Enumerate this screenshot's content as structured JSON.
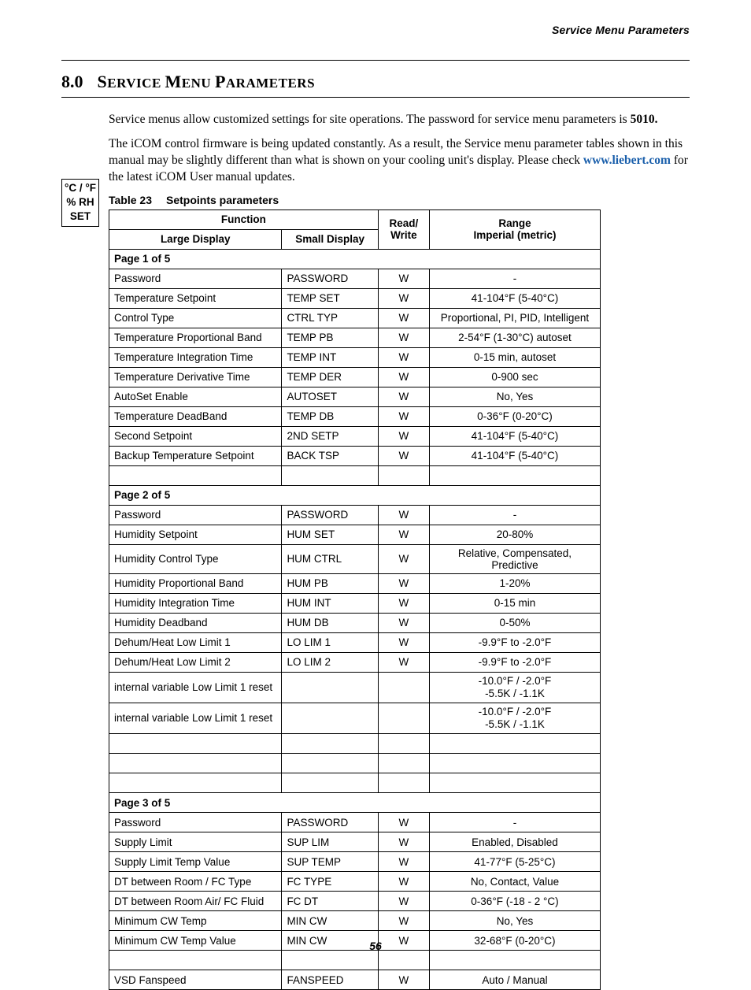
{
  "running_head": "Service Menu Parameters",
  "section_number": "8.0",
  "section_title_caps": "S",
  "section_title_rest": "ERVICE MENU PARAMETERS",
  "section_title_plain_1": "S",
  "section_title_plain_2": "ERVICE ",
  "section_title_plain_3": "M",
  "section_title_plain_4": "ENU ",
  "section_title_plain_5": "P",
  "section_title_plain_6": "ARAMETERS",
  "para1_a": "Service menus allow customized settings for site operations. The password for service menu parameters is ",
  "para1_b": "5010.",
  "para2_a": "The iCOM control firmware is being updated constantly. As a result, the Service menu parameter tables shown in this manual may be slightly different than what is shown on your cooling unit's display. Please check ",
  "para2_link": "www.liebert.com",
  "para2_b": " for the latest iCOM User manual updates.",
  "margin_box_l1": "°C / °F",
  "margin_box_l2": "% RH",
  "margin_box_l3": "SET",
  "table_label": "Table 23",
  "table_title": "Setpoints parameters",
  "thead": {
    "function": "Function",
    "large": "Large Display",
    "small": "Small Display",
    "rw1": "Read/",
    "rw2": "Write",
    "range1": "Range",
    "range2": "Imperial (metric)"
  },
  "rows": [
    {
      "type": "section",
      "label": "Page 1 of 5"
    },
    {
      "large": "Password",
      "small": "PASSWORD",
      "rw": "W",
      "range": "-"
    },
    {
      "large": "Temperature Setpoint",
      "small": "TEMP SET",
      "rw": "W",
      "range": "41-104°F (5-40°C)"
    },
    {
      "large": "Control Type",
      "small": "CTRL TYP",
      "rw": "W",
      "range": "Proportional, PI, PID, Intelligent"
    },
    {
      "large": "Temperature Proportional Band",
      "small": "TEMP PB",
      "rw": "W",
      "range": "2-54°F (1-30°C) autoset"
    },
    {
      "large": "Temperature Integration Time",
      "small": "TEMP INT",
      "rw": "W",
      "range": "0-15 min, autoset"
    },
    {
      "large": "Temperature Derivative Time",
      "small": "TEMP DER",
      "rw": "W",
      "range": "0-900 sec"
    },
    {
      "large": "AutoSet Enable",
      "small": "AUTOSET",
      "rw": "W",
      "range": "No, Yes"
    },
    {
      "large": "Temperature DeadBand",
      "small": "TEMP DB",
      "rw": "W",
      "range": "0-36°F (0-20°C)"
    },
    {
      "large": "Second Setpoint",
      "small": "2ND SETP",
      "rw": "W",
      "range": "41-104°F (5-40°C)"
    },
    {
      "large": "Backup Temperature Setpoint",
      "small": "BACK TSP",
      "rw": "W",
      "range": "41-104°F (5-40°C)"
    },
    {
      "type": "blank"
    },
    {
      "type": "section",
      "label": "Page 2 of 5"
    },
    {
      "large": "Password",
      "small": "PASSWORD",
      "rw": "W",
      "range": "-"
    },
    {
      "large": "Humidity Setpoint",
      "small": "HUM SET",
      "rw": "W",
      "range": "20-80%"
    },
    {
      "large": "Humidity Control Type",
      "small": "HUM CTRL",
      "rw": "W",
      "range": "Relative, Compensated, Predictive"
    },
    {
      "large": "Humidity Proportional Band",
      "small": "HUM PB",
      "rw": "W",
      "range": "1-20%"
    },
    {
      "large": "Humidity Integration Time",
      "small": "HUM INT",
      "rw": "W",
      "range": "0-15 min"
    },
    {
      "large": "Humidity Deadband",
      "small": "HUM DB",
      "rw": "W",
      "range": "0-50%"
    },
    {
      "large": "Dehum/Heat Low Limit 1",
      "small": "LO LIM 1",
      "rw": "W",
      "range": "-9.9°F to -2.0°F"
    },
    {
      "large": "Dehum/Heat Low Limit 2",
      "small": "LO LIM 2",
      "rw": "W",
      "range": "-9.9°F to -2.0°F"
    },
    {
      "large": "internal variable Low Limit 1 reset",
      "small": "",
      "rw": "",
      "range": "-10.0°F / -2.0°F\n-5.5K / -1.1K",
      "twoline": true
    },
    {
      "large": "internal variable Low Limit 1 reset",
      "small": "",
      "rw": "",
      "range": "-10.0°F / -2.0°F\n-5.5K / -1.1K",
      "twoline": true
    },
    {
      "type": "blank"
    },
    {
      "type": "blank"
    },
    {
      "type": "blank"
    },
    {
      "type": "section",
      "label": "Page 3 of 5"
    },
    {
      "large": "Password",
      "small": "PASSWORD",
      "rw": "W",
      "range": "-"
    },
    {
      "large": "Supply Limit",
      "small": "SUP LIM",
      "rw": "W",
      "range": "Enabled, Disabled"
    },
    {
      "large": "Supply Limit Temp Value",
      "small": "SUP TEMP",
      "rw": "W",
      "range": "41-77°F (5-25°C)"
    },
    {
      "large": "DT between Room / FC Type",
      "small": "FC TYPE",
      "rw": "W",
      "range": "No, Contact, Value"
    },
    {
      "large": "DT between Room Air/ FC Fluid",
      "small": "FC DT",
      "rw": "W",
      "range": "0-36°F (-18 - 2 °C)"
    },
    {
      "large": "Minimum CW Temp",
      "small": "MIN CW",
      "rw": "W",
      "range": "No, Yes"
    },
    {
      "large": "Minimum CW Temp Value",
      "small": "MIN CW",
      "rw": "W",
      "range": "32-68°F (0-20°C)"
    },
    {
      "type": "blank"
    },
    {
      "large": "VSD Fanspeed",
      "small": "FANSPEED",
      "rw": "W",
      "range": "Auto / Manual"
    }
  ],
  "page_number": "56"
}
